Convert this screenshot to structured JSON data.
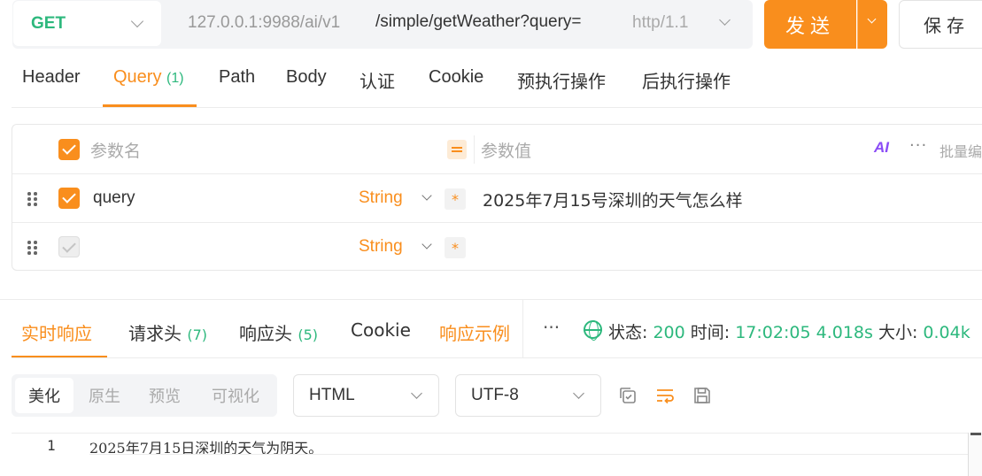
{
  "request": {
    "method": "GET",
    "base_url": "127.0.0.1:9988/ai/v1",
    "path": "/simple/getWeather?query=",
    "protocol": "http/1.1",
    "send_label": "发送",
    "save_label": "保存"
  },
  "request_tabs": [
    {
      "label": "Header"
    },
    {
      "label": "Query",
      "count": "(1)"
    },
    {
      "label": "Path"
    },
    {
      "label": "Body"
    },
    {
      "label": "认证"
    },
    {
      "label": "Cookie"
    },
    {
      "label": "预执行操作"
    },
    {
      "label": "后执行操作"
    }
  ],
  "params": {
    "header_name": "参数名",
    "header_value": "参数值",
    "ai_label": "AI",
    "more_label": "···",
    "bulk_label": "批量编辑",
    "rows": [
      {
        "name": "query",
        "type": "String",
        "required": "*",
        "value": "2025年7月15号深圳的天气怎么样",
        "checked": true
      },
      {
        "name": "",
        "type": "String",
        "required": "*",
        "value": "",
        "checked": false
      }
    ]
  },
  "response_tabs": [
    {
      "label": "实时响应"
    },
    {
      "label": "请求头",
      "count": "(7)"
    },
    {
      "label": "响应头",
      "count": "(5)"
    },
    {
      "label": "Cookie"
    },
    {
      "label": "响应示例"
    }
  ],
  "response_status": {
    "more_label": "···",
    "status_label": "状态:",
    "status_value": "200",
    "time_label": "时间:",
    "time_value": "17:02:05",
    "duration_value": "4.018s",
    "size_label": "大小:",
    "size_value": "0.04k"
  },
  "view_modes": [
    "美化",
    "原生",
    "预览",
    "可视化"
  ],
  "format_select": "HTML",
  "encoding_select": "UTF-8",
  "response_body": [
    {
      "line": "1",
      "text": "2025年7月15日深圳的天气为阴天。"
    }
  ],
  "colors": {
    "accent": "#f98e1d",
    "success": "#2db87d",
    "ai": "#8b4cf6"
  }
}
